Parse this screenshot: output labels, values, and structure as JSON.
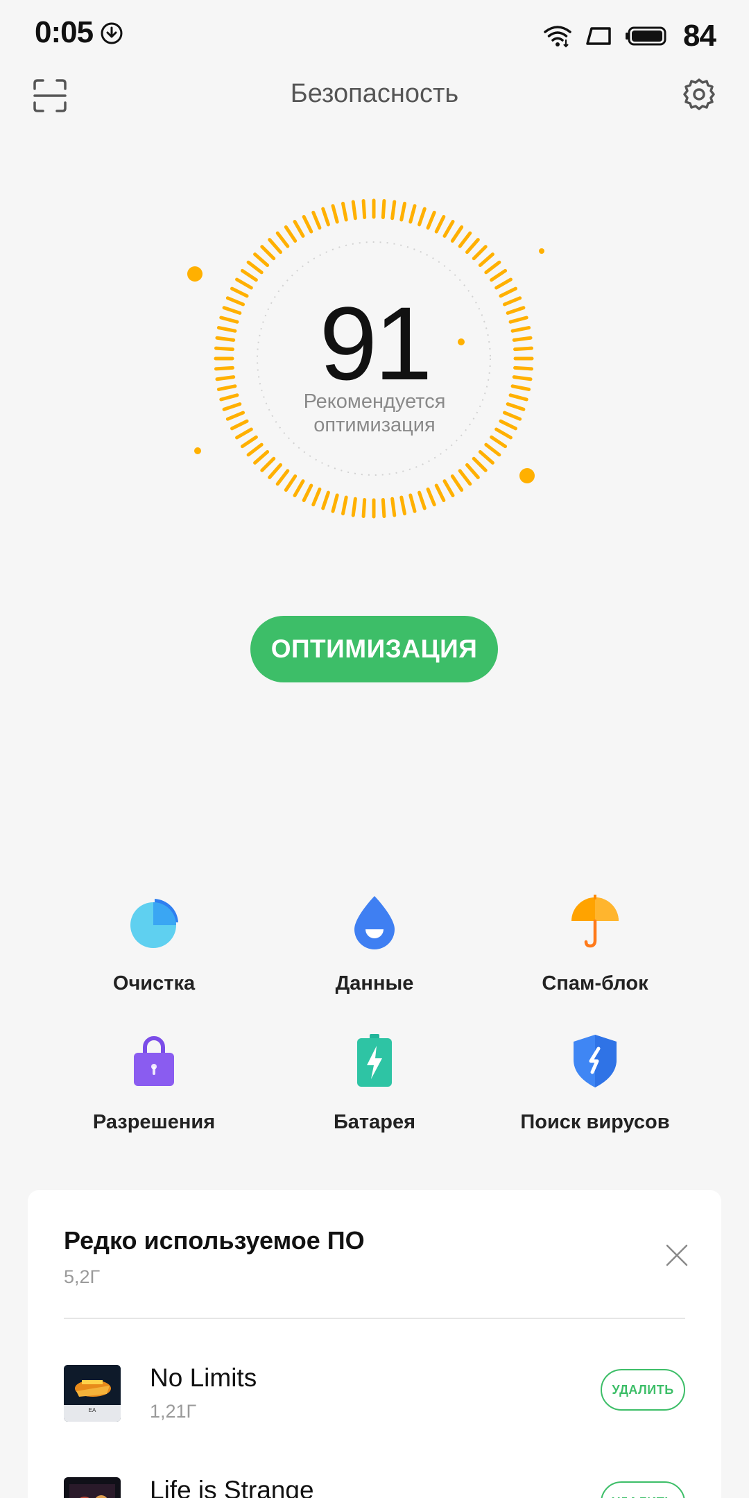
{
  "status_bar": {
    "time": "0:05",
    "battery_percent": "84",
    "icons": [
      "download-icon",
      "wifi-icon",
      "screen-rotate-icon",
      "battery-icon"
    ]
  },
  "header": {
    "title": "Безопасность",
    "left_icon": "scan-icon",
    "right_icon": "settings-icon"
  },
  "score": {
    "value": "91",
    "subtitle_line1": "Рекомендуется",
    "subtitle_line2": "оптимизация",
    "accent": "#FFB000"
  },
  "optimize_button": {
    "label": "ОПТИМИЗАЦИЯ",
    "color": "#3DBE68"
  },
  "tools": [
    {
      "label": "Очистка",
      "icon": "cleanup-pie-icon"
    },
    {
      "label": "Данные",
      "icon": "data-drop-icon"
    },
    {
      "label": "Спам-блок",
      "icon": "umbrella-icon"
    },
    {
      "label": "Разрешения",
      "icon": "lock-icon"
    },
    {
      "label": "Батарея",
      "icon": "battery-bolt-icon"
    },
    {
      "label": "Поиск вирусов",
      "icon": "shield-icon"
    }
  ],
  "rarely_used": {
    "title": "Редко используемое ПО",
    "size": "5,2Г",
    "apps": [
      {
        "name": "No Limits",
        "size": "1,21Г",
        "action": "УДАЛИТЬ"
      },
      {
        "name": "Life is Strange",
        "size": "",
        "action": "УДАЛИТЬ"
      }
    ]
  }
}
